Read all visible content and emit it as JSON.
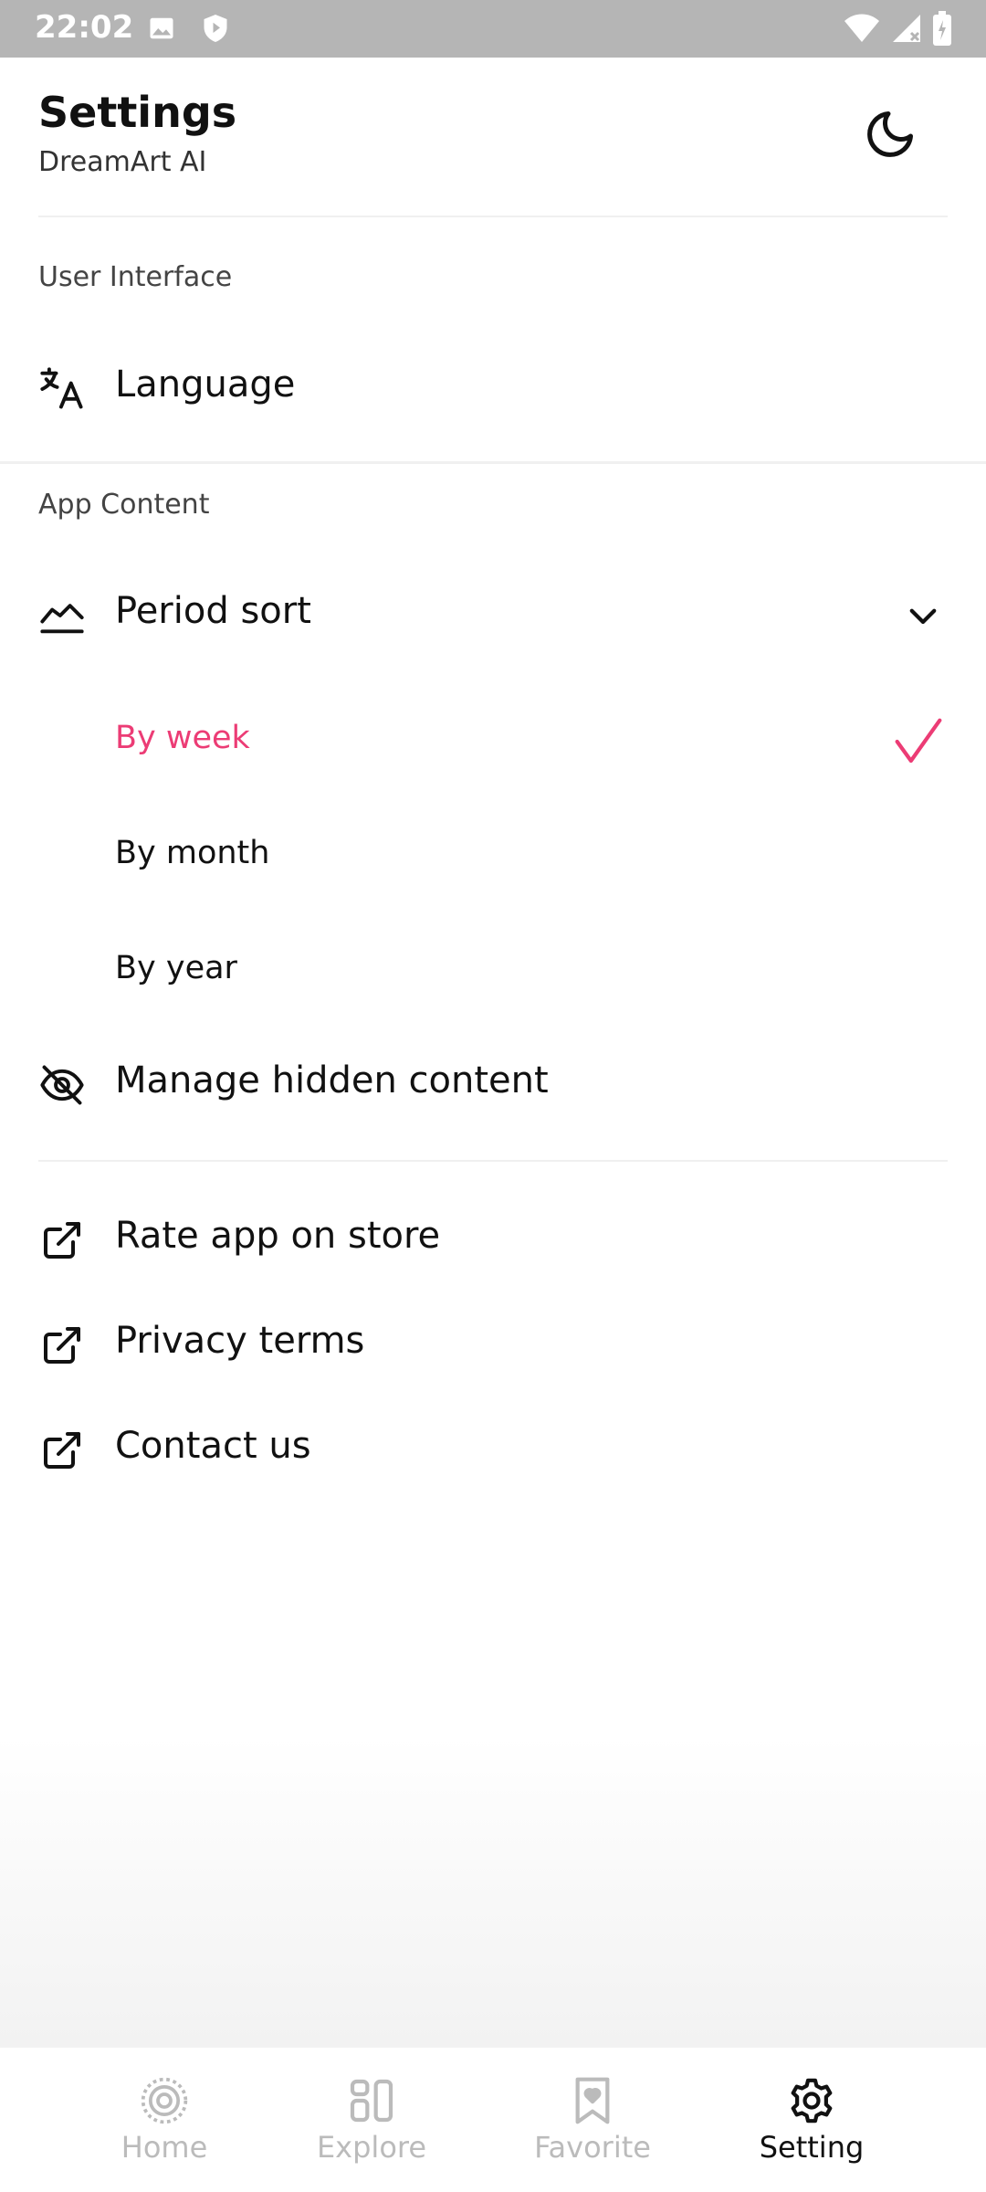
{
  "status_bar": {
    "time": "22:02"
  },
  "header": {
    "title": "Settings",
    "subtitle": "DreamArt AI",
    "theme_icon": "moon-icon"
  },
  "sections": {
    "user_interface": {
      "label": "User Interface",
      "items": [
        {
          "label": "Language",
          "icon": "translate-icon"
        }
      ]
    },
    "app_content": {
      "label": "App Content",
      "period_sort": {
        "label": "Period sort",
        "icon": "trend-icon",
        "expanded": true,
        "options": [
          {
            "label": "By week",
            "selected": true
          },
          {
            "label": "By month",
            "selected": false
          },
          {
            "label": "By year",
            "selected": false
          }
        ]
      },
      "manage_hidden": {
        "label": "Manage hidden content",
        "icon": "eye-off-icon"
      }
    },
    "links": [
      {
        "label": "Rate app on store",
        "icon": "external-link-icon"
      },
      {
        "label": "Privacy terms",
        "icon": "external-link-icon"
      },
      {
        "label": "Contact us",
        "icon": "external-link-icon"
      }
    ]
  },
  "bottom_nav": [
    {
      "label": "Home",
      "icon": "home-icon",
      "active": false
    },
    {
      "label": "Explore",
      "icon": "explore-icon",
      "active": false
    },
    {
      "label": "Favorite",
      "icon": "bookmark-heart-icon",
      "active": false
    },
    {
      "label": "Setting",
      "icon": "gear-icon",
      "active": true
    }
  ],
  "colors": {
    "accent": "#ec3c75",
    "status_bar": "#b5b5b5",
    "inactive_nav": "#bbbbbb"
  }
}
